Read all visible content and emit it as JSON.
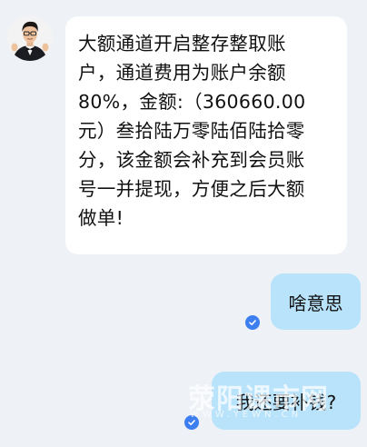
{
  "chat": {
    "incoming": {
      "lines": [
        "大额通道开启整存整取账",
        "户，通道费用为账户余额",
        "80%，金额:（360660.00",
        "元）叁拾陆万零陆佰陆拾零",
        "分，该金额会补充到会员账",
        "号一并提现，方便之后大额",
        "做单!"
      ]
    },
    "outgoing": [
      {
        "text": "啥意思",
        "status": "read"
      },
      {
        "text": "我还要补钱?",
        "status": "read"
      }
    ]
  },
  "icons": {
    "avatar": "avatar-person-icon",
    "read_status": "check-circle-icon"
  },
  "watermark": {
    "main": "荥阳课市网",
    "sub": "WWW.YEWN.CN"
  },
  "colors": {
    "background": "#eef1f6",
    "incoming_bubble": "#ffffff",
    "outgoing_bubble": "#b9e3fb",
    "read_check": "#3d7ef0"
  }
}
